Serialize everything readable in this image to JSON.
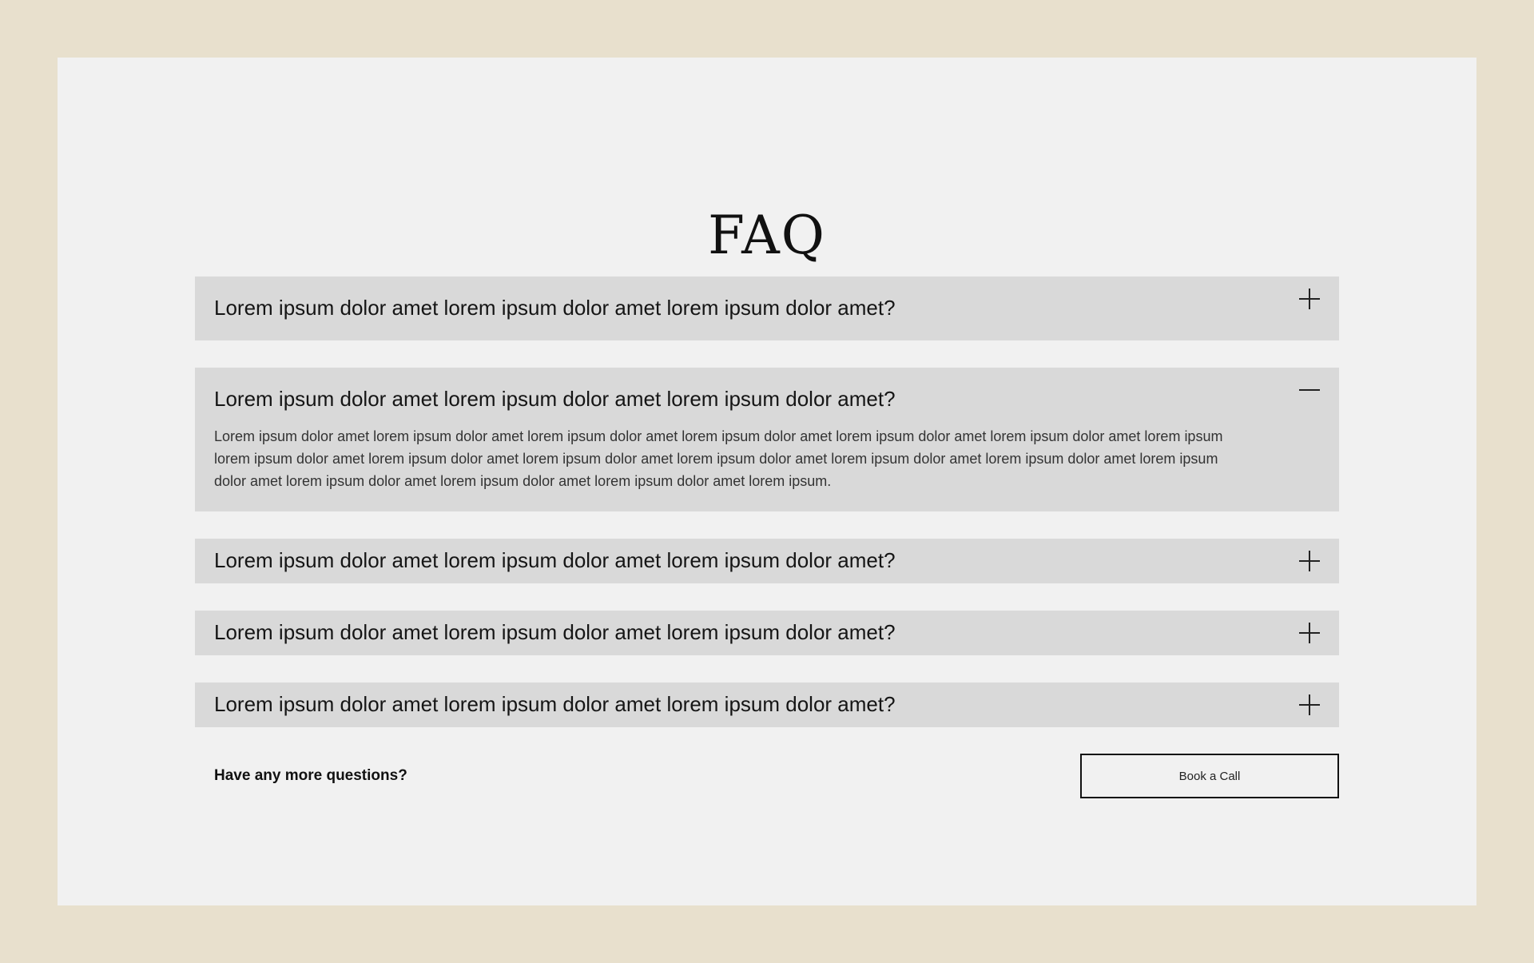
{
  "page": {
    "title": "FAQ"
  },
  "faq": {
    "items": [
      {
        "question": "Lorem ipsum dolor amet lorem ipsum dolor amet lorem ipsum dolor amet?",
        "expanded": false,
        "icon": "plus-icon"
      },
      {
        "question": "Lorem ipsum dolor amet lorem ipsum dolor amet lorem ipsum dolor amet?",
        "expanded": true,
        "icon": "minus-icon",
        "answer": "Lorem ipsum dolor amet lorem ipsum dolor amet lorem ipsum dolor amet lorem ipsum dolor amet lorem ipsum dolor amet lorem ipsum dolor amet lorem ipsum lorem ipsum dolor amet lorem ipsum dolor amet lorem ipsum dolor amet lorem ipsum dolor amet lorem ipsum dolor amet lorem ipsum dolor amet lorem ipsum dolor amet lorem ipsum dolor amet lorem ipsum dolor amet lorem ipsum dolor amet lorem ipsum."
      },
      {
        "question": "Lorem ipsum dolor amet lorem ipsum dolor amet lorem ipsum dolor amet?",
        "expanded": false,
        "icon": "plus-icon"
      },
      {
        "question": "Lorem ipsum dolor amet lorem ipsum dolor amet lorem ipsum dolor amet?",
        "expanded": false,
        "icon": "plus-icon"
      },
      {
        "question": "Lorem ipsum dolor amet lorem ipsum dolor amet lorem ipsum dolor amet?",
        "expanded": false,
        "icon": "plus-icon"
      }
    ]
  },
  "footer": {
    "prompt": "Have any more questions?",
    "button_label": "Book a Call"
  },
  "colors": {
    "background": "#e8e0cd",
    "panel": "#f1f1f1",
    "item": "#d9d9d9",
    "text": "#151515"
  }
}
